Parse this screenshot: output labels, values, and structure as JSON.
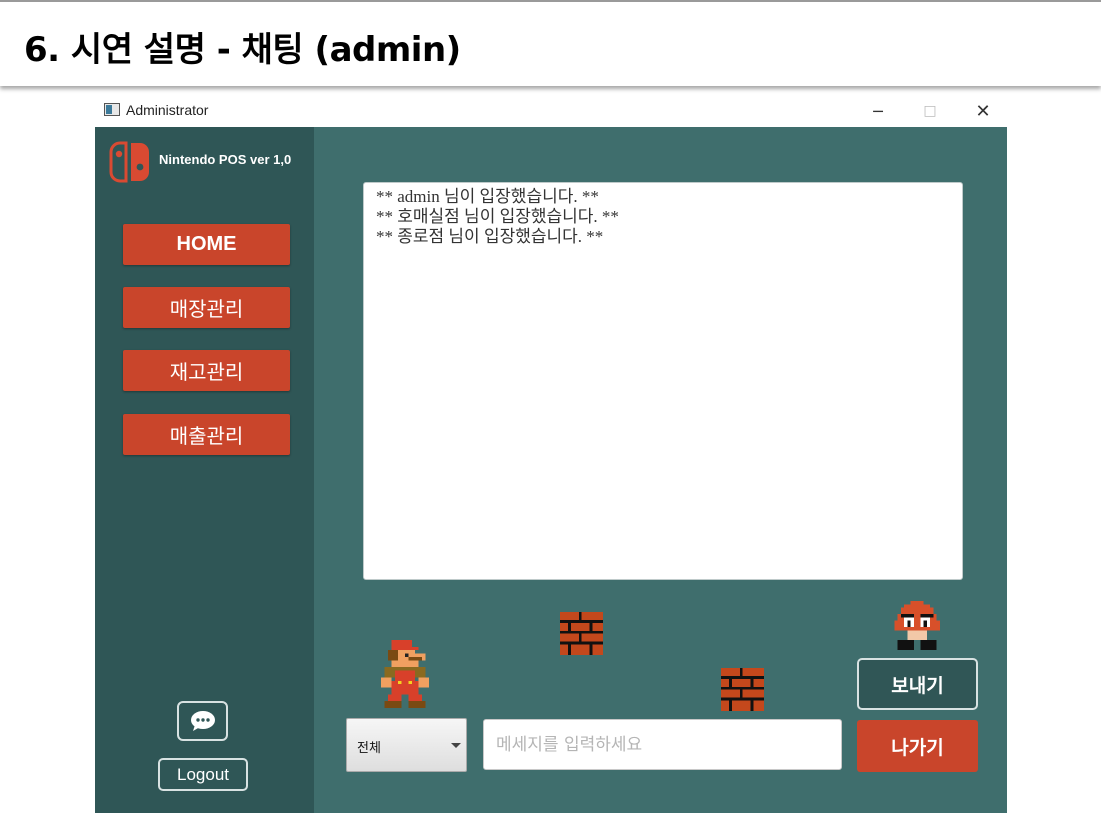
{
  "slide": {
    "title": "6. 시연 설명 - 채팅 (admin)"
  },
  "window": {
    "title": "Administrator",
    "controls": {
      "minimize": "─",
      "maximize": "□",
      "close": "✕"
    }
  },
  "sidebar": {
    "brand": "Nintendo POS ver 1,0",
    "nav": [
      {
        "label": "HOME"
      },
      {
        "label": "매장관리"
      },
      {
        "label": "재고관리"
      },
      {
        "label": "매출관리"
      }
    ],
    "chat_icon": "chat-bubble-icon",
    "logout_label": "Logout"
  },
  "chat": {
    "messages": [
      "** admin 님이 입장했습니다. **",
      "** 호매실점 님이 입장했습니다. **",
      "** 종로점 님이 입장했습니다. **"
    ],
    "target_select": {
      "value": "전체"
    },
    "input": {
      "value": "",
      "placeholder": "메세지를 입력하세요"
    },
    "send_label": "보내기",
    "exit_label": "나가기"
  },
  "colors": {
    "sidebar_bg": "#2f5656",
    "main_bg": "#3f6e6d",
    "accent": "#c9452b"
  }
}
